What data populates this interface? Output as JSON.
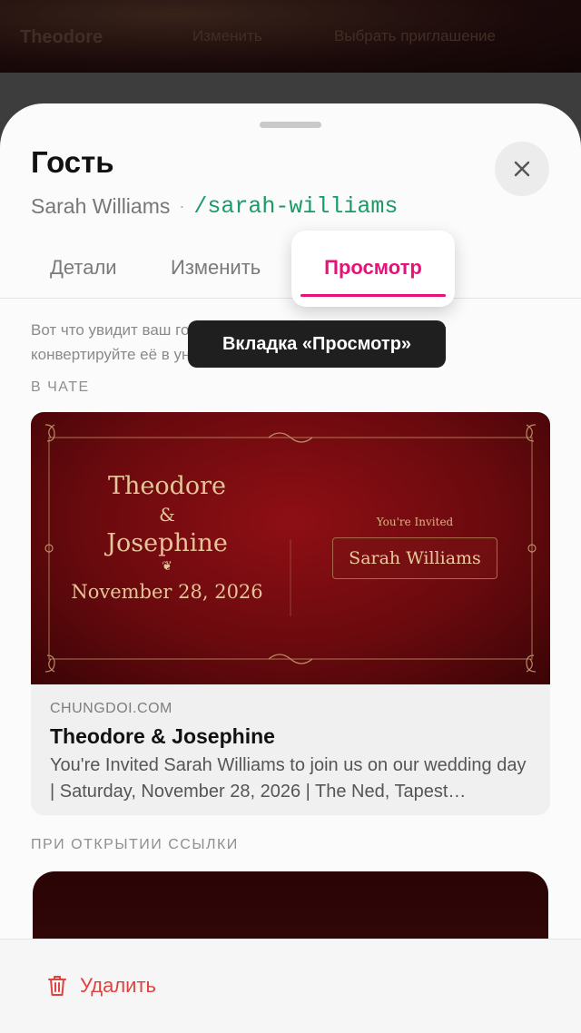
{
  "background": {
    "couple": "Theodore",
    "edit_label": "Изменить",
    "select_template_label": "Выбрать приглашение"
  },
  "sheet": {
    "title": "Гость",
    "guest_name": "Sarah Williams",
    "separator": "·",
    "slug": "/sarah-williams",
    "tabs": [
      {
        "label": "Детали"
      },
      {
        "label": "Изменить"
      },
      {
        "label": "Просмотр",
        "active": true
      }
    ],
    "tooltip": "Вкладка «Просмотр»",
    "description": "Вот что увидит ваш гость в чате, когда вы её отправите, и конвертируйте её в уникальную ссылку.",
    "section_chat": "В ЧАТЕ",
    "section_open": "ПРИ ОТКРЫТИИ ССЫЛКИ",
    "delete_label": "Удалить"
  },
  "card": {
    "name1": "Theodore",
    "amp": "&",
    "name2": "Josephine",
    "heart": "❦",
    "date": "November 28, 2026",
    "invited_label": "You're Invited",
    "invited_name": "Sarah Williams",
    "domain": "CHUNGDOI.COM",
    "title": "Theodore & Josephine",
    "desc": "You're Invited Sarah Williams to join us on our wedding day | Saturday, November 28, 2026 | The Ned, Tapest…"
  },
  "colors": {
    "accent": "#e6127a",
    "slug": "#1a9a66",
    "danger": "#e0423f",
    "card_red": "#8e0f14",
    "gold": "#e6c49a"
  }
}
